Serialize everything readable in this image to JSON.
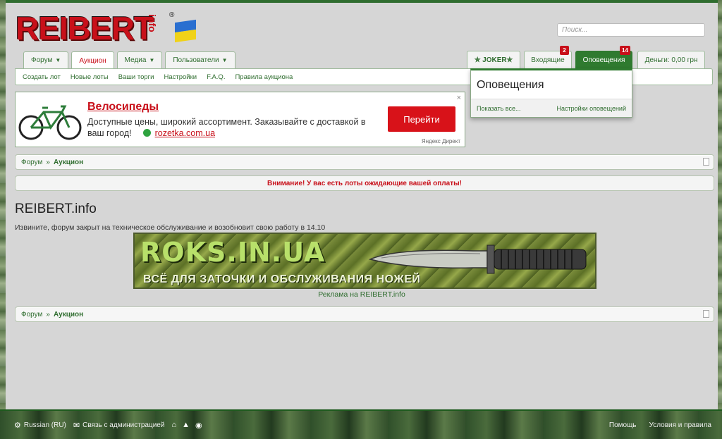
{
  "header": {
    "logo_text": "REIBERT",
    "logo_sub": "info",
    "logo_reg": "®",
    "search_placeholder": "Поиск..."
  },
  "tabs": [
    {
      "label": "Форум",
      "has_menu": true
    },
    {
      "label": "Аукцион",
      "has_menu": false,
      "active": true
    },
    {
      "label": "Медиа",
      "has_menu": true
    },
    {
      "label": "Пользователи",
      "has_menu": true
    }
  ],
  "subnav": [
    "Создать лот",
    "Новые лоты",
    "Ваши торги",
    "Настройки",
    "F.A.Q.",
    "Правила аукциона"
  ],
  "account_nav": {
    "user": "✮ JOKER✮",
    "inbox": {
      "label": "Входящие",
      "count": "2"
    },
    "notifications": {
      "label": "Оповещения",
      "count": "14"
    },
    "money": "Деньги: 0,00 грн"
  },
  "notifications_popup": {
    "title": "Оповещения",
    "show_all": "Показать все...",
    "settings": "Настройки оповещений"
  },
  "ad": {
    "title": "Велосипеды",
    "description": "Доступные цены, широкий ассортимент. Заказывайте с доставкой в ваш город!",
    "domain": "rozetka.com.ua",
    "button": "Перейти",
    "source": "Яндекс Директ",
    "close": "×"
  },
  "breadcrumb": {
    "forum": "Форум",
    "sep": "»",
    "current": "Аукцион"
  },
  "alert": "Внимание! У вас есть лоты ожидающие вашей оплаты!",
  "page_title": "REIBERT.info",
  "maintenance": "Извините, форум закрыт на техническое обслуживание и возобновит свою работу в 14.10",
  "banner": {
    "site": "ROKS.IN.UA",
    "tagline": "ВСЁ ДЛЯ ЗАТОЧКИ И ОБСЛУЖИВАНИЯ НОЖЕЙ",
    "caption": "Реклама на REIBERT.info"
  },
  "footer": {
    "language": "Russian (RU)",
    "contact": "Связь с администрацией",
    "help": "Помощь",
    "terms": "Условия и правила"
  },
  "colors": {
    "accent_green": "#2f7a2f",
    "brand_red": "#c8101a"
  }
}
